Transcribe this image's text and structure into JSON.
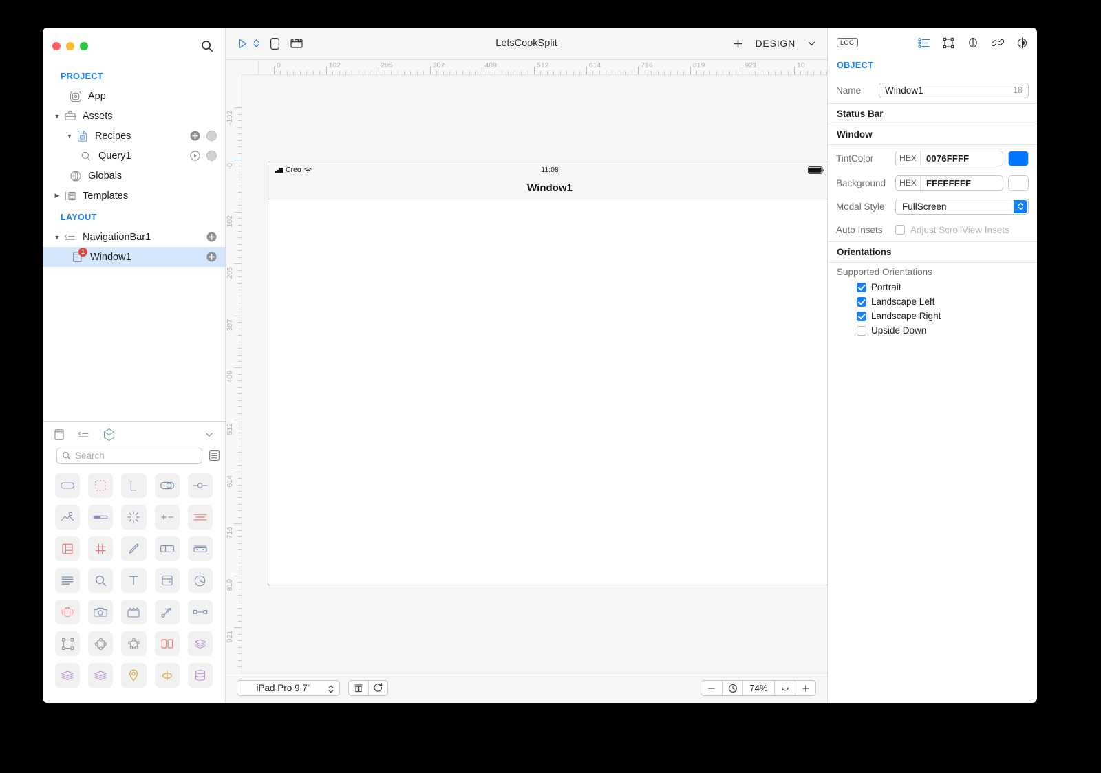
{
  "window": {
    "title": "LetsCookSplit"
  },
  "sidebar": {
    "search_icon": "search-icon",
    "groups": [
      {
        "label": "PROJECT",
        "items": [
          {
            "label": "App",
            "icon": "app-icon",
            "indent": 1,
            "disclosure": "none",
            "actions": []
          },
          {
            "label": "Assets",
            "icon": "briefcase-icon",
            "indent": 0,
            "disclosure": "open",
            "actions": []
          },
          {
            "label": "Recipes",
            "icon": "document-icon",
            "indent": 1,
            "disclosure": "open",
            "actions": [
              "plus-icon",
              "circle-icon"
            ]
          },
          {
            "label": "Query1",
            "icon": "magnifier-icon",
            "indent": 2,
            "disclosure": "none",
            "actions": [
              "play-icon",
              "circle-icon"
            ]
          },
          {
            "label": "Globals",
            "icon": "globals-icon",
            "indent": 1,
            "disclosure": "none",
            "actions": []
          },
          {
            "label": "Templates",
            "icon": "templates-icon",
            "indent": 0,
            "disclosure": "closed",
            "actions": []
          }
        ]
      },
      {
        "label": "LAYOUT",
        "items": [
          {
            "label": "NavigationBar1",
            "icon": "navbar-icon",
            "indent": 0,
            "disclosure": "open",
            "actions": [
              "plus-icon"
            ]
          },
          {
            "label": "Window1",
            "icon": "window-icon",
            "indent": 1,
            "disclosure": "none",
            "actions": [
              "plus-icon"
            ],
            "selected": true,
            "badge": "1"
          }
        ]
      }
    ]
  },
  "palette": {
    "tabs": [
      "panel-icon",
      "list-icon",
      "cube-icon"
    ],
    "collapse_icon": "chevron-down-icon",
    "search_placeholder": "Search",
    "search_value": "",
    "list_toggle_icon": "list-view-icon",
    "items": [
      "rounded-rect-icon",
      "dashed-rect-icon",
      "label-L-icon",
      "switch-icon",
      "slider-icon",
      "image-icon",
      "progress-bar-icon",
      "activity-indicator-icon",
      "stepper-icon",
      "segmented-icon",
      "table-icon",
      "grid-icon",
      "pen-icon",
      "split-view-icon",
      "keyboard-icon",
      "text-view-icon",
      "search-bar-icon",
      "text-T-icon",
      "web-view-icon",
      "pie-chart-icon",
      "vibrate-icon",
      "camera-icon",
      "media-icon",
      "path-icon",
      "connector-icon",
      "bounds-icon",
      "circle-anchor-icon",
      "polygon-icon",
      "columns-icon",
      "stack-icon",
      "stack-icon-2",
      "stack-icon-3",
      "map-pin-icon",
      "ellipse-axis-icon",
      "database-icon"
    ]
  },
  "toolbar": {
    "run_icon": "play-icon",
    "run_stepper_icon": "stepper-icon",
    "device_icon": "device-icon",
    "template_icon": "template-icon",
    "add_icon": "plus-icon",
    "mode_label": "DESIGN",
    "mode_chevron": "chevron-down-icon"
  },
  "canvas": {
    "ruler_h_labels": [
      "0",
      "102",
      "205",
      "307",
      "409",
      "512",
      "614",
      "716",
      "819",
      "921",
      "10"
    ],
    "ruler_v_labels": [
      "-102",
      "-0",
      "102",
      "205",
      "307",
      "409",
      "512",
      "614",
      "716",
      "819",
      "921"
    ],
    "device": {
      "carrier": "Creo",
      "time": "11:08",
      "wifi_icon": "wifi-icon",
      "signal_icon": "signal-bars-icon",
      "battery_icon": "battery-icon",
      "navbar_title": "Window1"
    }
  },
  "bottom_bar": {
    "device_select": "iPad Pro 9.7\"",
    "layout_icon": "layout-icon",
    "refresh_icon": "refresh-icon",
    "zoom_out_icon": "minus-icon",
    "zoom_fit_icon": "fit-icon",
    "zoom_level": "74%",
    "zoom_actual_icon": "actual-size-icon",
    "zoom_in_icon": "plus-icon"
  },
  "inspector": {
    "log_label": "LOG",
    "icons": [
      "attributes-icon",
      "layout-icon",
      "identity-icon",
      "connections-icon",
      "effects-icon"
    ],
    "title": "OBJECT",
    "name_label": "Name",
    "name_value": "Window1",
    "name_trailing": "18",
    "sections": {
      "status_bar": "Status Bar",
      "window": "Window",
      "orientations": "Orientations"
    },
    "tint_label": "TintColor",
    "tint_hex_tag": "HEX",
    "tint_hex_value": "0076FFFF",
    "tint_swatch_color": "#0076ff",
    "background_label": "Background",
    "background_hex_tag": "HEX",
    "background_hex_value": "FFFFFFFF",
    "background_swatch_color": "#ffffff",
    "modal_style_label": "Modal Style",
    "modal_style_value": "FullScreen",
    "auto_insets_label": "Auto Insets",
    "auto_insets_checkbox_label": "Adjust ScrollView Insets",
    "auto_insets_checked": false,
    "supported_orientations_label": "Supported Orientations",
    "orientations": [
      {
        "label": "Portrait",
        "checked": true
      },
      {
        "label": "Landscape Left",
        "checked": true
      },
      {
        "label": "Landscape Right",
        "checked": true
      },
      {
        "label": "Upside Down",
        "checked": false
      }
    ]
  }
}
